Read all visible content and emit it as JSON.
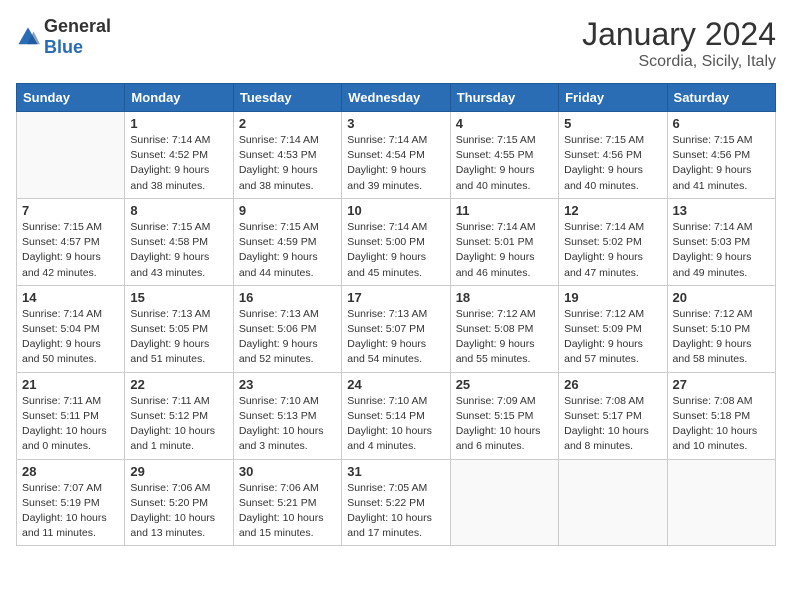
{
  "header": {
    "logo_general": "General",
    "logo_blue": "Blue",
    "title": "January 2024",
    "location": "Scordia, Sicily, Italy"
  },
  "days_of_week": [
    "Sunday",
    "Monday",
    "Tuesday",
    "Wednesday",
    "Thursday",
    "Friday",
    "Saturday"
  ],
  "weeks": [
    [
      {
        "day": "",
        "info": ""
      },
      {
        "day": "1",
        "info": "Sunrise: 7:14 AM\nSunset: 4:52 PM\nDaylight: 9 hours\nand 38 minutes."
      },
      {
        "day": "2",
        "info": "Sunrise: 7:14 AM\nSunset: 4:53 PM\nDaylight: 9 hours\nand 38 minutes."
      },
      {
        "day": "3",
        "info": "Sunrise: 7:14 AM\nSunset: 4:54 PM\nDaylight: 9 hours\nand 39 minutes."
      },
      {
        "day": "4",
        "info": "Sunrise: 7:15 AM\nSunset: 4:55 PM\nDaylight: 9 hours\nand 40 minutes."
      },
      {
        "day": "5",
        "info": "Sunrise: 7:15 AM\nSunset: 4:56 PM\nDaylight: 9 hours\nand 40 minutes."
      },
      {
        "day": "6",
        "info": "Sunrise: 7:15 AM\nSunset: 4:56 PM\nDaylight: 9 hours\nand 41 minutes."
      }
    ],
    [
      {
        "day": "7",
        "info": "Sunrise: 7:15 AM\nSunset: 4:57 PM\nDaylight: 9 hours\nand 42 minutes."
      },
      {
        "day": "8",
        "info": "Sunrise: 7:15 AM\nSunset: 4:58 PM\nDaylight: 9 hours\nand 43 minutes."
      },
      {
        "day": "9",
        "info": "Sunrise: 7:15 AM\nSunset: 4:59 PM\nDaylight: 9 hours\nand 44 minutes."
      },
      {
        "day": "10",
        "info": "Sunrise: 7:14 AM\nSunset: 5:00 PM\nDaylight: 9 hours\nand 45 minutes."
      },
      {
        "day": "11",
        "info": "Sunrise: 7:14 AM\nSunset: 5:01 PM\nDaylight: 9 hours\nand 46 minutes."
      },
      {
        "day": "12",
        "info": "Sunrise: 7:14 AM\nSunset: 5:02 PM\nDaylight: 9 hours\nand 47 minutes."
      },
      {
        "day": "13",
        "info": "Sunrise: 7:14 AM\nSunset: 5:03 PM\nDaylight: 9 hours\nand 49 minutes."
      }
    ],
    [
      {
        "day": "14",
        "info": "Sunrise: 7:14 AM\nSunset: 5:04 PM\nDaylight: 9 hours\nand 50 minutes."
      },
      {
        "day": "15",
        "info": "Sunrise: 7:13 AM\nSunset: 5:05 PM\nDaylight: 9 hours\nand 51 minutes."
      },
      {
        "day": "16",
        "info": "Sunrise: 7:13 AM\nSunset: 5:06 PM\nDaylight: 9 hours\nand 52 minutes."
      },
      {
        "day": "17",
        "info": "Sunrise: 7:13 AM\nSunset: 5:07 PM\nDaylight: 9 hours\nand 54 minutes."
      },
      {
        "day": "18",
        "info": "Sunrise: 7:12 AM\nSunset: 5:08 PM\nDaylight: 9 hours\nand 55 minutes."
      },
      {
        "day": "19",
        "info": "Sunrise: 7:12 AM\nSunset: 5:09 PM\nDaylight: 9 hours\nand 57 minutes."
      },
      {
        "day": "20",
        "info": "Sunrise: 7:12 AM\nSunset: 5:10 PM\nDaylight: 9 hours\nand 58 minutes."
      }
    ],
    [
      {
        "day": "21",
        "info": "Sunrise: 7:11 AM\nSunset: 5:11 PM\nDaylight: 10 hours\nand 0 minutes."
      },
      {
        "day": "22",
        "info": "Sunrise: 7:11 AM\nSunset: 5:12 PM\nDaylight: 10 hours\nand 1 minute."
      },
      {
        "day": "23",
        "info": "Sunrise: 7:10 AM\nSunset: 5:13 PM\nDaylight: 10 hours\nand 3 minutes."
      },
      {
        "day": "24",
        "info": "Sunrise: 7:10 AM\nSunset: 5:14 PM\nDaylight: 10 hours\nand 4 minutes."
      },
      {
        "day": "25",
        "info": "Sunrise: 7:09 AM\nSunset: 5:15 PM\nDaylight: 10 hours\nand 6 minutes."
      },
      {
        "day": "26",
        "info": "Sunrise: 7:08 AM\nSunset: 5:17 PM\nDaylight: 10 hours\nand 8 minutes."
      },
      {
        "day": "27",
        "info": "Sunrise: 7:08 AM\nSunset: 5:18 PM\nDaylight: 10 hours\nand 10 minutes."
      }
    ],
    [
      {
        "day": "28",
        "info": "Sunrise: 7:07 AM\nSunset: 5:19 PM\nDaylight: 10 hours\nand 11 minutes."
      },
      {
        "day": "29",
        "info": "Sunrise: 7:06 AM\nSunset: 5:20 PM\nDaylight: 10 hours\nand 13 minutes."
      },
      {
        "day": "30",
        "info": "Sunrise: 7:06 AM\nSunset: 5:21 PM\nDaylight: 10 hours\nand 15 minutes."
      },
      {
        "day": "31",
        "info": "Sunrise: 7:05 AM\nSunset: 5:22 PM\nDaylight: 10 hours\nand 17 minutes."
      },
      {
        "day": "",
        "info": ""
      },
      {
        "day": "",
        "info": ""
      },
      {
        "day": "",
        "info": ""
      }
    ]
  ]
}
